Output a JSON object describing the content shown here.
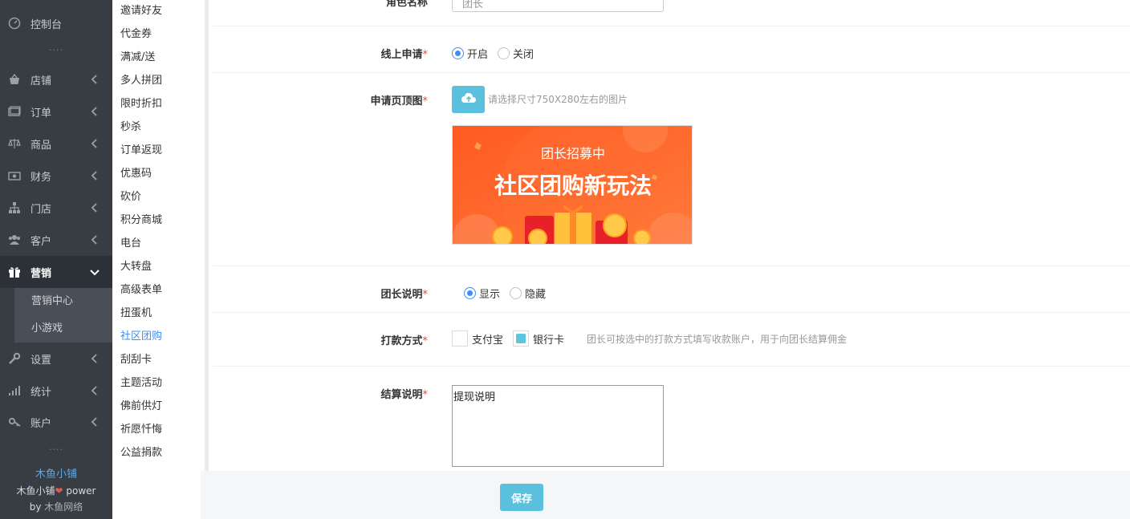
{
  "sidebar": {
    "items": [
      {
        "label": "控制台",
        "icon": "dashboard-icon"
      },
      {
        "label": "店铺",
        "icon": "shop-icon"
      },
      {
        "label": "订单",
        "icon": "order-icon"
      },
      {
        "label": "商品",
        "icon": "scale-icon"
      },
      {
        "label": "财务",
        "icon": "money-icon"
      },
      {
        "label": "门店",
        "icon": "sitemap-icon"
      },
      {
        "label": "客户",
        "icon": "users-icon"
      },
      {
        "label": "营销",
        "icon": "gift-icon"
      },
      {
        "label": "设置",
        "icon": "wrench-icon"
      },
      {
        "label": "统计",
        "icon": "bar-chart-icon"
      },
      {
        "label": "账户",
        "icon": "key-icon"
      }
    ],
    "marketing_sub": [
      "营销中心",
      "小游戏"
    ],
    "dots": "····",
    "brand": {
      "name": "木鱼小铺",
      "line2_a": "木鱼小铺",
      "heart": "❤",
      "line2_b": " power",
      "by": "by ",
      "by_name": "木鱼网络"
    }
  },
  "submenu": [
    "邀请好友",
    "代金券",
    "满减/送",
    "多人拼团",
    "限时折扣",
    "秒杀",
    "订单返现",
    "优惠码",
    "砍价",
    "积分商城",
    "电台",
    "大转盘",
    "高级表单",
    "扭蛋机",
    "社区团购",
    "刮刮卡",
    "主题活动",
    "佛前供灯",
    "祈愿忏悔",
    "公益捐款"
  ],
  "form": {
    "top_label": "角色名称",
    "top_value": "团长",
    "online_apply": {
      "label": "线上申请",
      "req": "*",
      "options": [
        "开启",
        "关闭"
      ],
      "selected": "开启"
    },
    "apply_image": {
      "label": "申请页顶图",
      "req": "*",
      "hint": "请选择尺寸750X280左右的图片",
      "banner_title": "团长招募中",
      "banner_main": "社区团购新玩法"
    },
    "leader_desc": {
      "label": "团长说明",
      "req": "*",
      "options": [
        "显示",
        "隐藏"
      ],
      "selected": "显示"
    },
    "payment": {
      "label": "打款方式",
      "req": "*",
      "options": [
        "支付宝",
        "银行卡"
      ],
      "checked": [
        "银行卡"
      ],
      "hint": "团长可按选中的打款方式填写收款账户，用于向团长结算佣金"
    },
    "settle_desc": {
      "label": "结算说明",
      "req": "*",
      "value": "提现说明"
    }
  },
  "save_label": "保存",
  "colors": {
    "accent": "#5bc0de",
    "link": "#3f8ef0",
    "sidebar": "#383d44",
    "required": "#e6463a"
  }
}
